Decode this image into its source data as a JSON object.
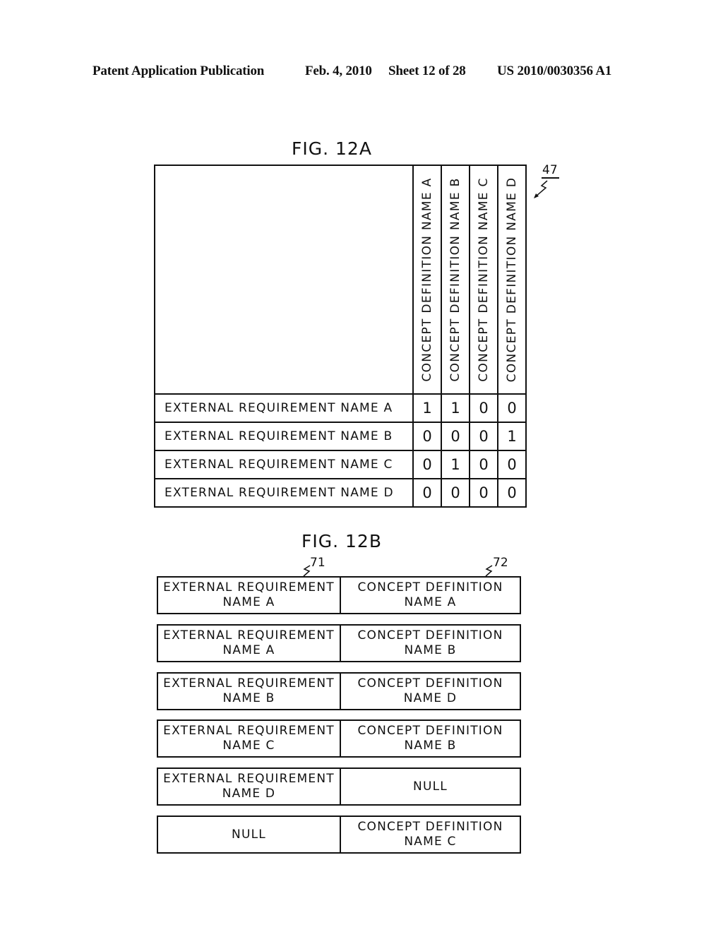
{
  "header": {
    "publication": "Patent Application Publication",
    "date": "Feb. 4, 2010",
    "sheet": "Sheet 12 of 28",
    "number": "US 2010/0030356 A1"
  },
  "fig12a": {
    "title": "FIG. 12A",
    "reference": "47",
    "columns": [
      "CONCEPT DEFINITION NAME  A",
      "CONCEPT DEFINITION NAME  B",
      "CONCEPT DEFINITION NAME  C",
      "CONCEPT DEFINITION NAME  D"
    ],
    "rows": [
      {
        "label": "EXTERNAL REQUIREMENT NAME  A",
        "values": [
          "1",
          "1",
          "0",
          "0"
        ]
      },
      {
        "label": "EXTERNAL REQUIREMENT NAME  B",
        "values": [
          "0",
          "0",
          "0",
          "1"
        ]
      },
      {
        "label": "EXTERNAL REQUIREMENT NAME  C",
        "values": [
          "0",
          "1",
          "0",
          "0"
        ]
      },
      {
        "label": "EXTERNAL REQUIREMENT NAME  D",
        "values": [
          "0",
          "0",
          "0",
          "0"
        ]
      }
    ]
  },
  "fig12b": {
    "title": "FIG. 12B",
    "ref_left": "71",
    "ref_right": "72",
    "records": [
      {
        "left": "EXTERNAL REQUIREMENT\nNAME  A",
        "right": "CONCEPT DEFINITION\nNAME  A"
      },
      {
        "left": "EXTERNAL REQUIREMENT\nNAME  A",
        "right": "CONCEPT DEFINITION\nNAME  B"
      },
      {
        "left": "EXTERNAL REQUIREMENT\nNAME  B",
        "right": "CONCEPT DEFINITION\nNAME  D"
      },
      {
        "left": "EXTERNAL REQUIREMENT\nNAME  C",
        "right": "CONCEPT DEFINITION\nNAME  B"
      },
      {
        "left": "EXTERNAL REQUIREMENT\nNAME  D",
        "right": "NULL"
      },
      {
        "left": "NULL",
        "right": "CONCEPT DEFINITION\nNAME  C"
      }
    ]
  }
}
